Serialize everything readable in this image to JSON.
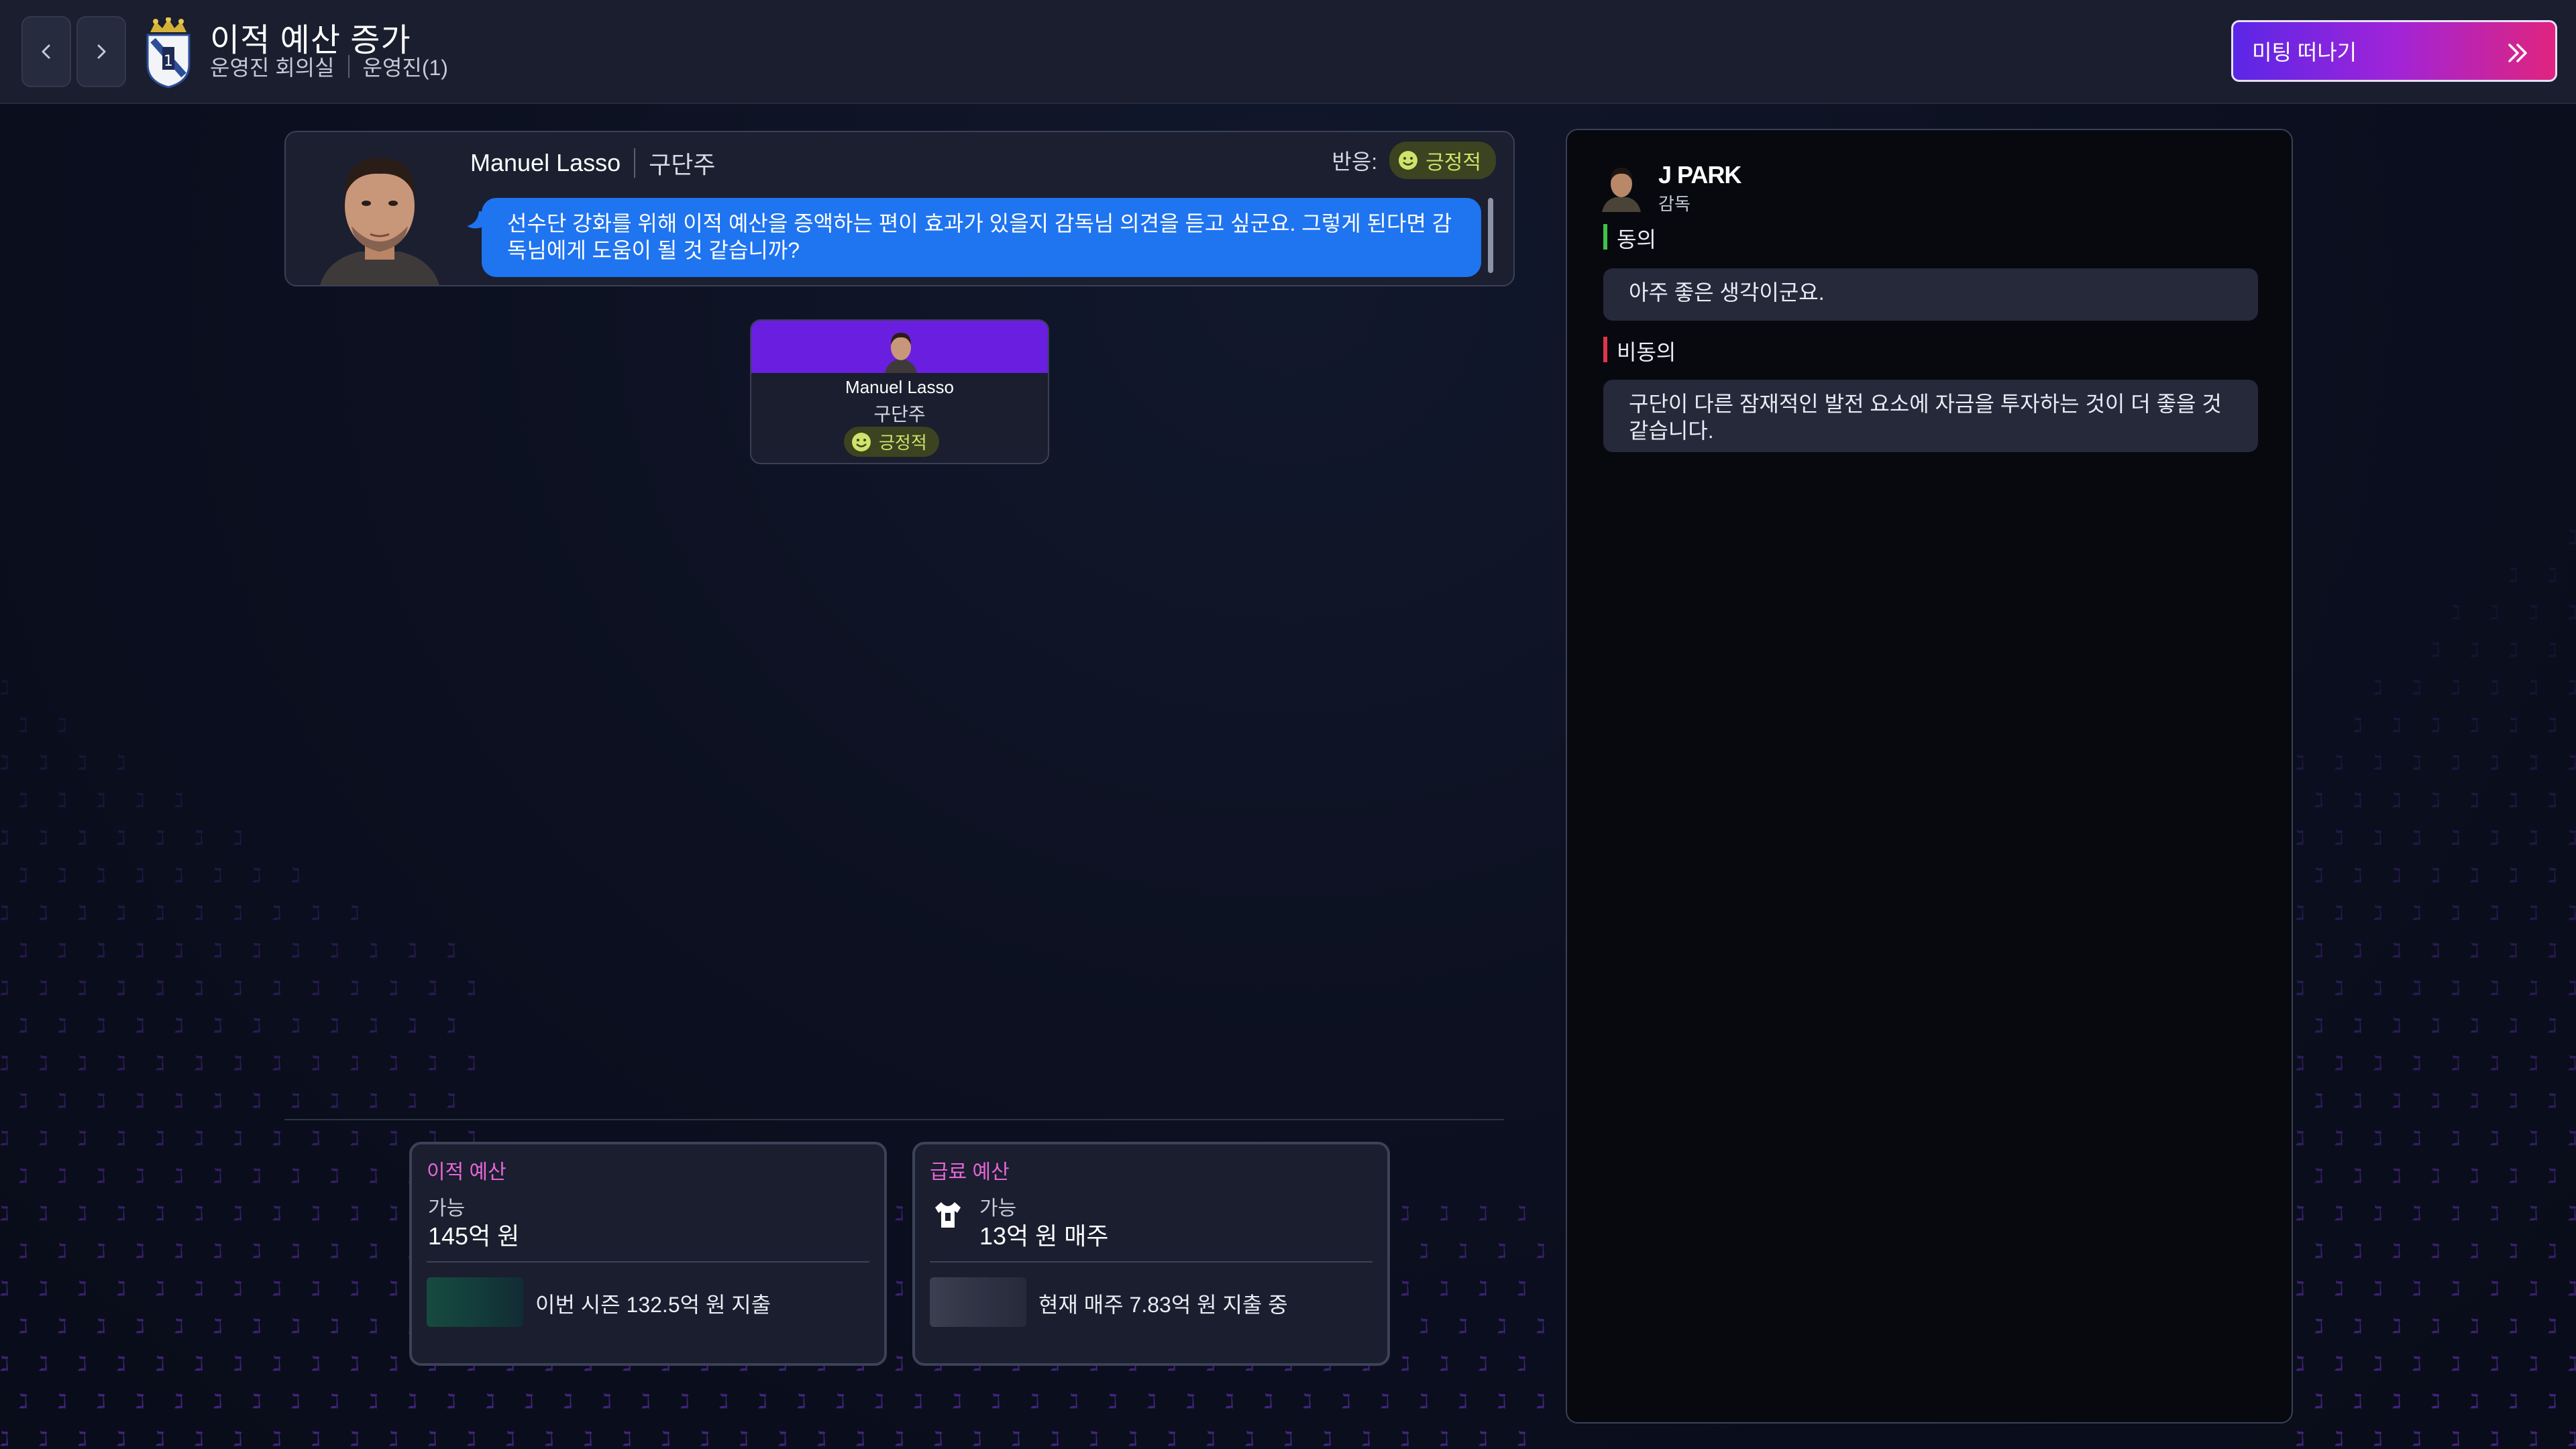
{
  "header": {
    "title": "이적 예산 증가",
    "subtitle": "운영진 회의실",
    "breadcrumb": "운영진(1)",
    "back_icon": "chevron-left-icon",
    "forward_icon": "chevron-right-icon",
    "leave_button": "미팅 떠나기"
  },
  "speaker": {
    "name": "Manuel Lasso",
    "role": "구단주",
    "reaction_label": "반응:",
    "reaction": "긍정적",
    "message": "선수단 강화를 위해 이적 예산을 증액하는 편이 효과가 있을지 감독님 의견을 듣고 싶군요. 그렇게 된다면 감독님에게 도움이 될 것 같습니까?"
  },
  "participant": {
    "name": "Manuel Lasso",
    "role": "구단주",
    "reaction": "긍정적"
  },
  "budgets": {
    "transfer": {
      "title": "이적 예산",
      "available_label": "가능",
      "amount": "145억 원",
      "note": "이번 시즌 132.5억 원 지출"
    },
    "wage": {
      "title": "급료 예산",
      "available_label": "가능",
      "amount": "13억 원 매주",
      "note": "현재 매주 7.83억 원 지출 중"
    }
  },
  "manager": {
    "name": "J PARK",
    "role": "감독",
    "options": [
      {
        "label": "동의",
        "text": "아주 좋은 생각이군요.",
        "color": "#3fc24a"
      },
      {
        "label": "비동의",
        "text": "구단이 다른 잠재적인 발전 요소에 자금을 투자하는 것이 더 좋을 것 같습니다.",
        "color": "#e0344a"
      }
    ]
  },
  "colors": {
    "accent_purple": "#6a1fe0",
    "bubble_blue": "#1f74f0",
    "positive_green": "#cfe26a",
    "budget_title": "#e566d8"
  }
}
